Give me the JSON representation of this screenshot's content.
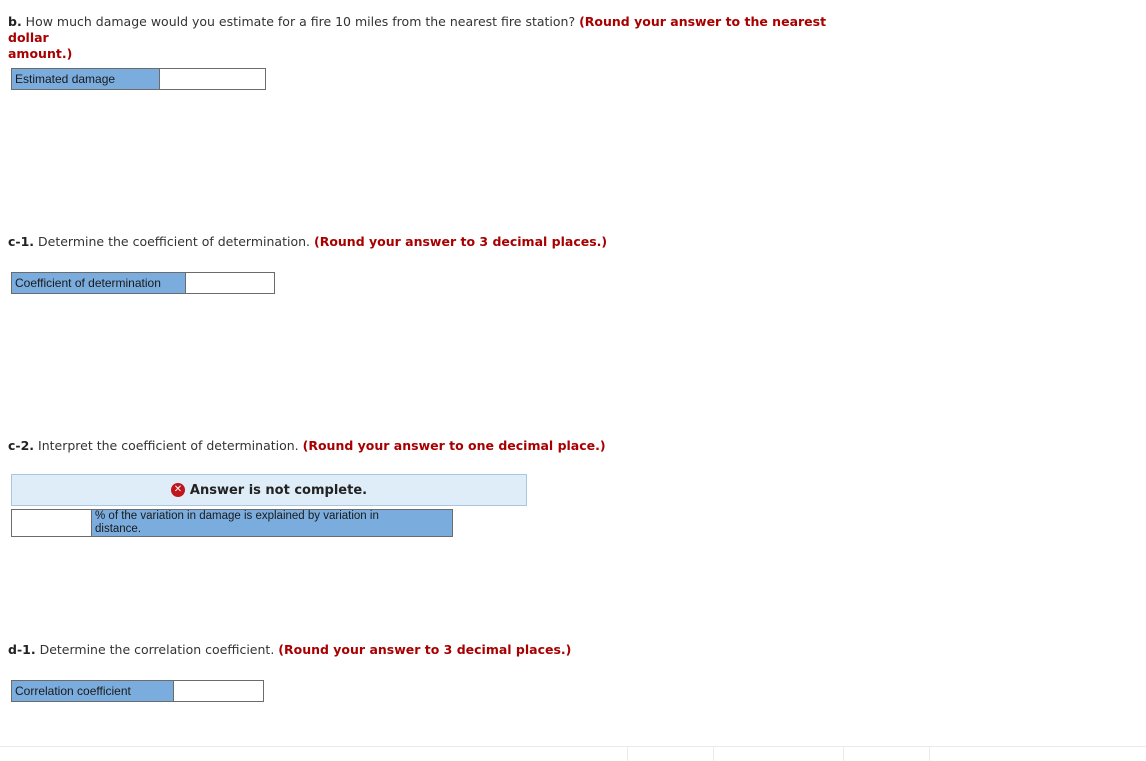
{
  "part_b": {
    "number": "b.",
    "text": " How much damage would you estimate for a fire 10 miles from the nearest fire station? ",
    "hint_line1": "(Round your answer to the nearest dollar",
    "hint_line2": "amount.)",
    "field_label": "Estimated damage",
    "field_value": ""
  },
  "part_c1": {
    "number": "c-1.",
    "text": " Determine the coefficient of determination. ",
    "hint": "(Round your answer to 3 decimal places.)",
    "field_label": "Coefficient of determination",
    "field_value": ""
  },
  "part_c2": {
    "number": "c-2.",
    "text": " Interpret the coefficient of determination. ",
    "hint": "(Round your answer to one decimal place.)",
    "banner_text": "Answer is not complete.",
    "field_value": "",
    "field_label_line1": "% of the variation in damage is explained by variation in",
    "field_label_line2": "distance."
  },
  "part_d1": {
    "number": "d-1.",
    "text": " Determine the correlation coefficient. ",
    "hint": "(Round your answer to 3 decimal places.)",
    "field_label": "Correlation coefficient",
    "field_value": ""
  },
  "icons": {
    "error_icon": "x-circle-icon",
    "error_color": "#c0161b",
    "label_bg": "#7bacde",
    "hint_color": "#a80000"
  }
}
